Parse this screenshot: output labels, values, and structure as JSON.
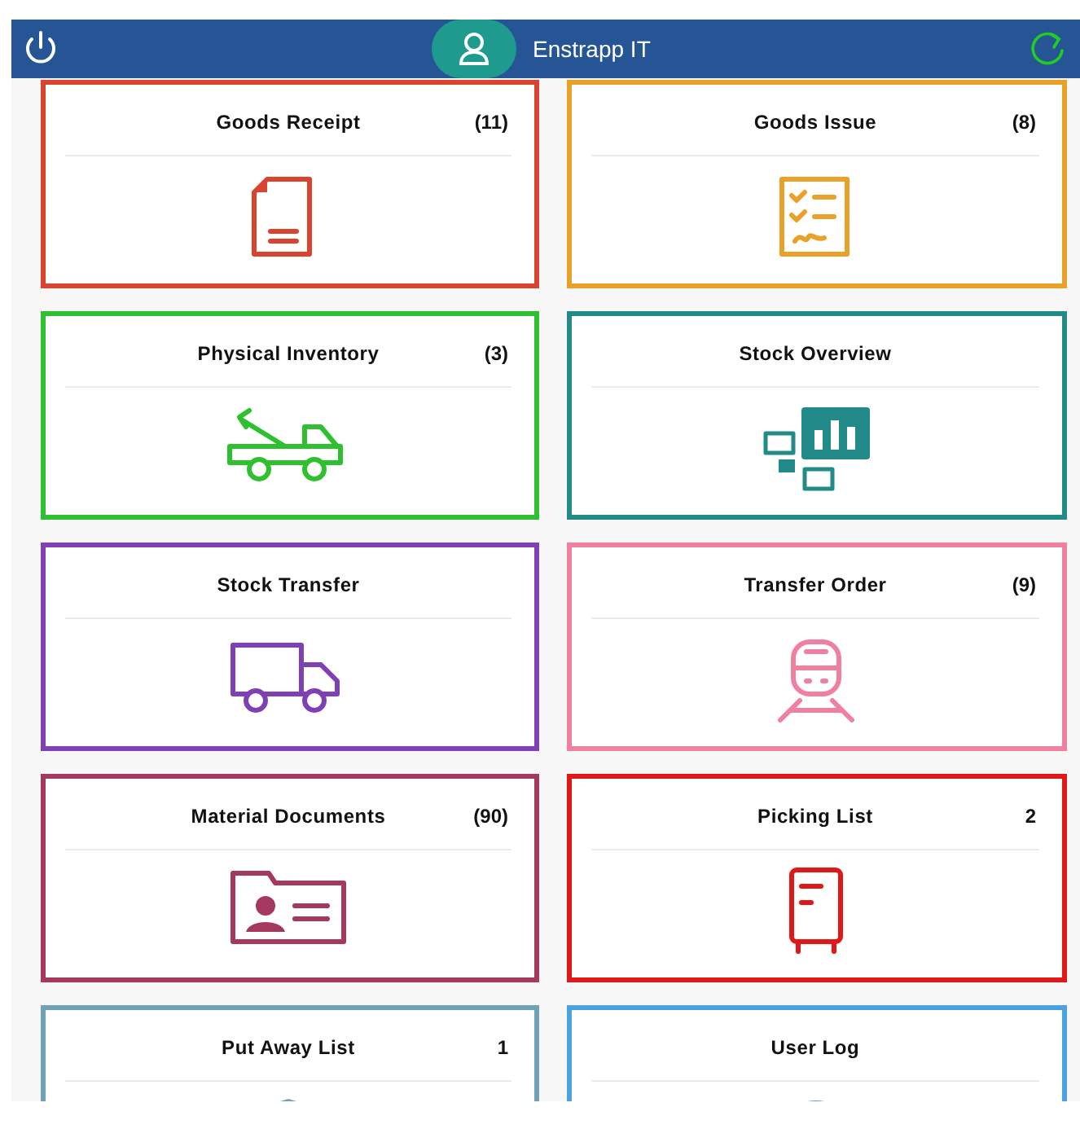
{
  "header": {
    "title": "Enstrapp IT"
  },
  "tiles": [
    {
      "title": "Goods Receipt",
      "count": "(11)",
      "color": "#d9432f"
    },
    {
      "title": "Goods Issue",
      "count": "(8)",
      "color": "#e9a12a"
    },
    {
      "title": "Physical Inventory",
      "count": "(3)",
      "color": "#2ec02e"
    },
    {
      "title": "Stock Overview",
      "color": "#238a8a"
    },
    {
      "title": "Stock Transfer",
      "color": "#7f3fb5"
    },
    {
      "title": "Transfer Order",
      "count": "(9)",
      "color": "#f07fa0"
    },
    {
      "title": "Material Documents",
      "count": "(90)",
      "color": "#a5385f"
    },
    {
      "title": "Picking List",
      "count": "2",
      "color": "#e01818"
    },
    {
      "title": "Put Away List",
      "count": "1",
      "color": "#6fa2b5"
    },
    {
      "title": "User Log",
      "color": "#4aa3e0"
    }
  ]
}
